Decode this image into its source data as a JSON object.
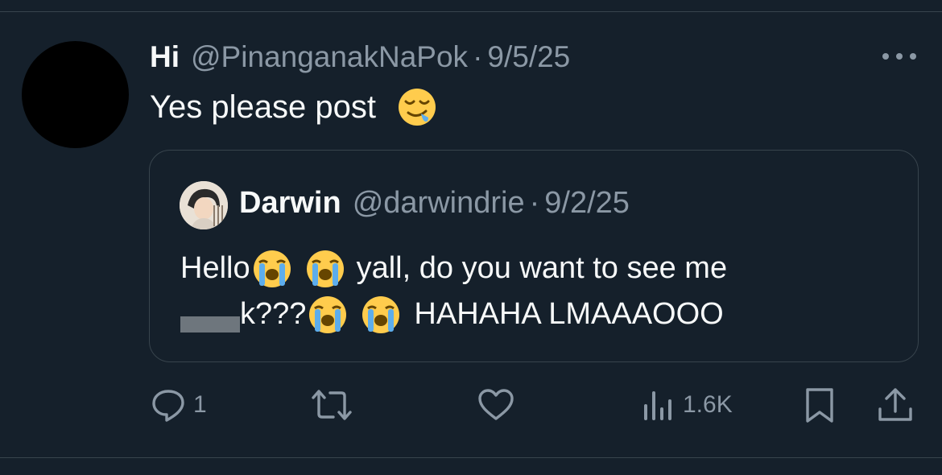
{
  "post": {
    "author_name": "Hi",
    "handle": "@PinanganakNaPok",
    "separator": "·",
    "date": "9/5/25",
    "text": "Yes please post",
    "emoji": "drooling-face"
  },
  "quote": {
    "author_name": "Darwin",
    "handle": "@darwindrie",
    "separator": "·",
    "date": "9/2/25",
    "line1_a": "Hello",
    "line1_b": "yall, do you want to see me",
    "line2_a": "k???",
    "line2_b": "HAHAHA LMAAAOOO",
    "emoji": "loudly-crying-face"
  },
  "actions": {
    "reply_count": "1",
    "retweet_count": "",
    "like_count": "",
    "views_count": "1.6K"
  },
  "colors": {
    "background": "#15202b",
    "muted": "#8b98a5",
    "border": "#38444d"
  }
}
